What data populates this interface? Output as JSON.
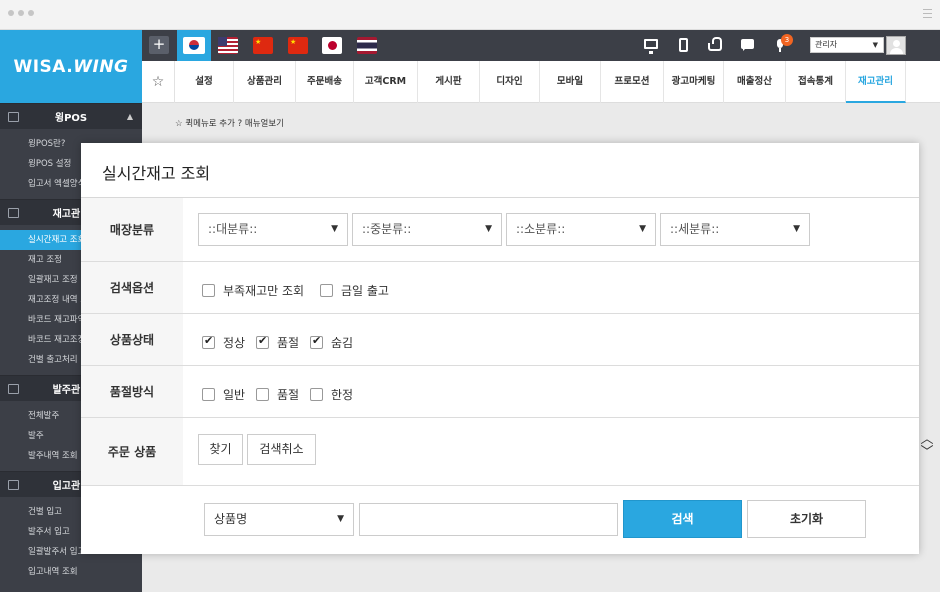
{
  "logo": {
    "text_a": "WISA.",
    "text_b": "WING"
  },
  "sidebar": {
    "sections": [
      {
        "title": "윙POS",
        "items": [
          "윙POS란?",
          "윙POS 설정",
          "입고서 엑셀양식"
        ]
      },
      {
        "title": "재고관리",
        "items": [
          "실시간재고 조회",
          "재고 조정",
          "일괄재고 조정",
          "재고조정 내역 조회",
          "바코드 재고파악",
          "바코드 재고조정",
          "건별 출고처리"
        ]
      },
      {
        "title": "발주관리",
        "items": [
          "전체발주",
          "발주",
          "발주내역 조회"
        ]
      },
      {
        "title": "입고관리",
        "items": [
          "건별 입고",
          "발주서 입고",
          "일괄발주서 입고",
          "입고내역 조회"
        ]
      }
    ],
    "active_item": "실시간재고 조회"
  },
  "topbar": {
    "plus_label": "+",
    "notification_count": "3",
    "admin_label": "관리자"
  },
  "menu": {
    "items": [
      "설정",
      "상품관리",
      "주문배송",
      "고객CRM",
      "게시판",
      "디자인",
      "모바일",
      "프로모션",
      "광고마케팅",
      "매출정산",
      "접속통계",
      "재고관리"
    ],
    "active": "재고관리"
  },
  "quick": {
    "add_label": "퀵메뉴로 추가",
    "help_label": "매뉴얼보기"
  },
  "modal": {
    "title": "실시간재고 조회",
    "rows": {
      "category": {
        "label": "매장분류",
        "selects": [
          "::대분류::",
          "::중분류::",
          "::소분류::",
          "::세분류::"
        ]
      },
      "search_option": {
        "label": "검색옵션",
        "checks": [
          {
            "label": "부족재고만 조회",
            "checked": false
          },
          {
            "label": "금일 출고",
            "checked": false
          }
        ]
      },
      "product_status": {
        "label": "상품상태",
        "checks": [
          {
            "label": "정상",
            "checked": true
          },
          {
            "label": "품절",
            "checked": true
          },
          {
            "label": "숨김",
            "checked": true
          }
        ]
      },
      "soldout_method": {
        "label": "품절방식",
        "checks": [
          {
            "label": "일반",
            "checked": false
          },
          {
            "label": "품절",
            "checked": false
          },
          {
            "label": "한정",
            "checked": false
          }
        ]
      },
      "order_product": {
        "label": "주문 상품",
        "find_label": "찾기",
        "cancel_label": "검색취소"
      }
    },
    "search": {
      "field_value": "상품명",
      "input_value": "",
      "search_label": "검색",
      "reset_label": "초기화"
    }
  }
}
